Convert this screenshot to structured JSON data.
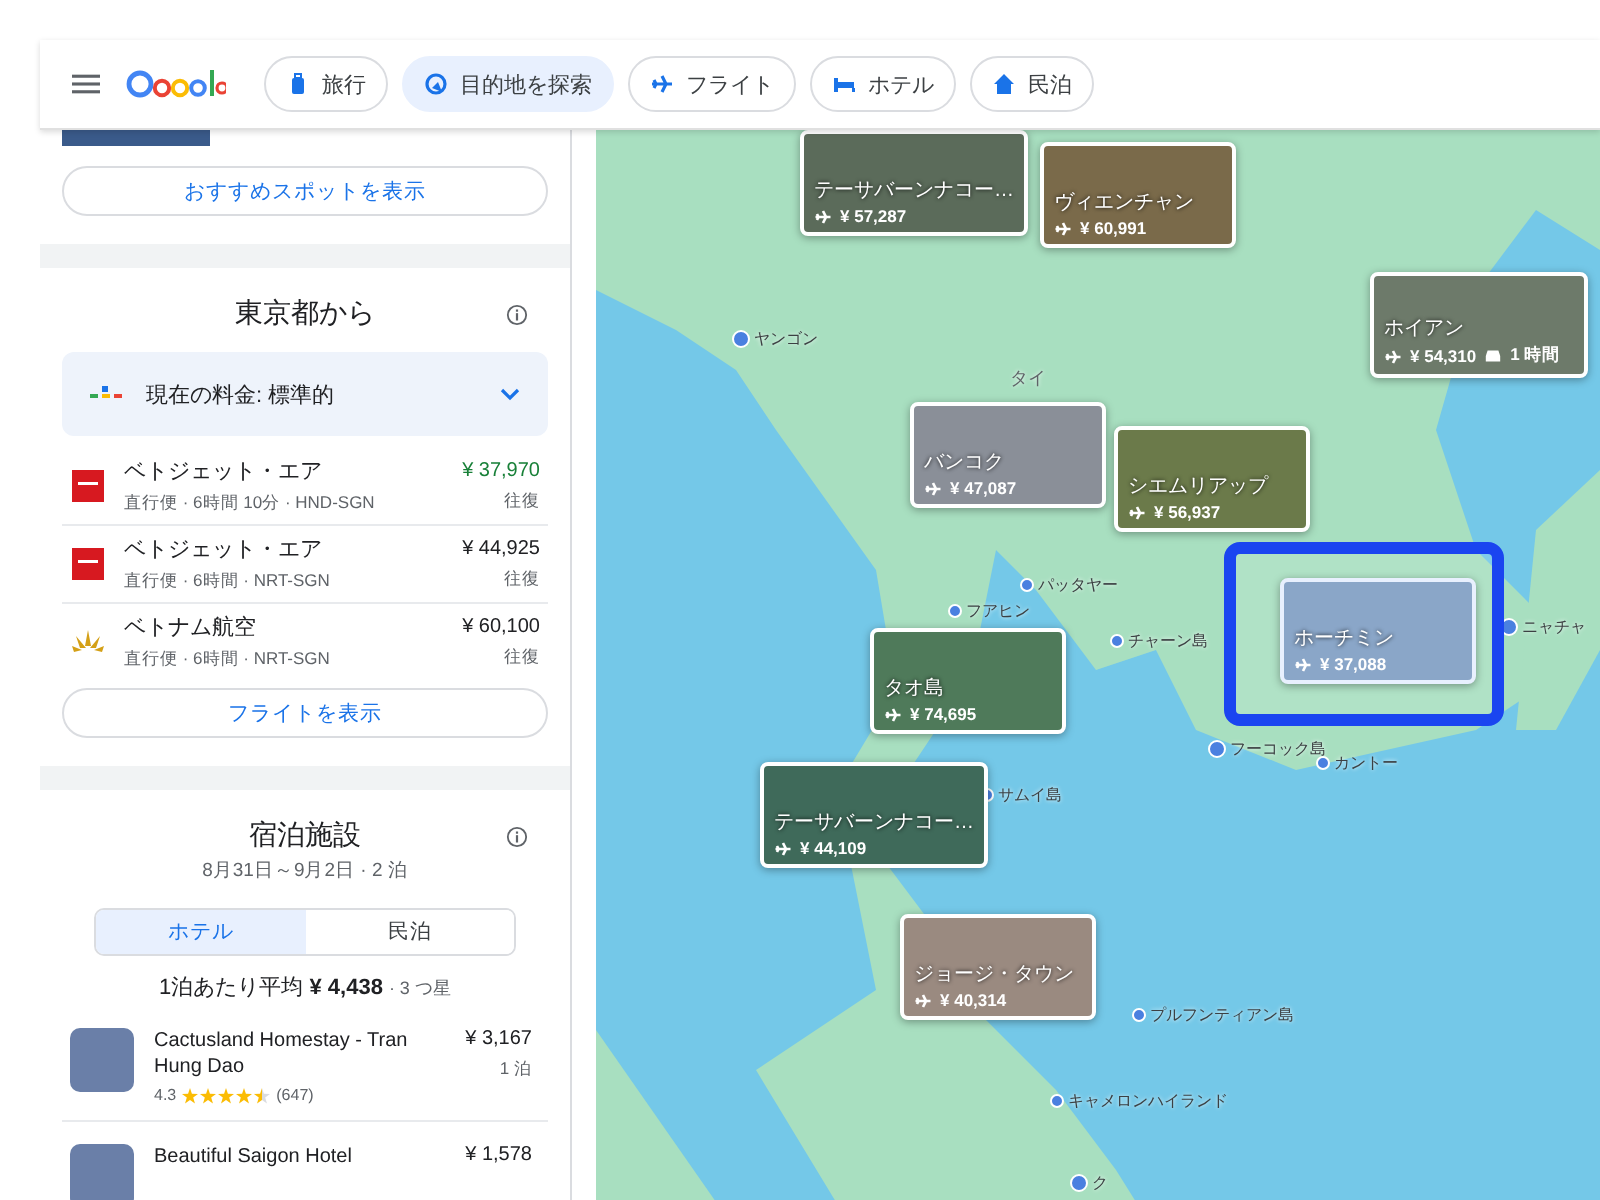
{
  "header": {
    "nav": [
      {
        "label": "旅行",
        "kind": "suitcase",
        "selected": false
      },
      {
        "label": "目的地を探索",
        "kind": "explore",
        "selected": true
      },
      {
        "label": "フライト",
        "kind": "plane",
        "selected": false
      },
      {
        "label": "ホテル",
        "kind": "bed",
        "selected": false
      },
      {
        "label": "民泊",
        "kind": "house",
        "selected": false
      }
    ]
  },
  "sidebar": {
    "spots_button": "おすすめスポットを表示",
    "flights": {
      "title": "東京都から",
      "price_status": "現在の料金: 標準的",
      "rows": [
        {
          "airline": "ベトジェット・エア",
          "details": "直行便 · 6時間 10分 · HND-SGN",
          "price": "¥ 37,970",
          "trip": "往復",
          "kind": "square",
          "color": "#188038"
        },
        {
          "airline": "ベトジェット・エア",
          "details": "直行便 · 6時間 · NRT-SGN",
          "price": "¥ 44,925",
          "trip": "往復",
          "kind": "square",
          "color": "#202124"
        },
        {
          "airline": "ベトナム航空",
          "details": "直行便 · 6時間 · NRT-SGN",
          "price": "¥ 60,100",
          "trip": "往復",
          "kind": "flower",
          "color": "#202124"
        }
      ],
      "button": "フライトを表示"
    },
    "stays": {
      "title": "宿泊施設",
      "dates": "8月31日～9月2日 · 2 泊",
      "tabs": [
        {
          "label": "ホテル",
          "selected": true
        },
        {
          "label": "民泊",
          "selected": false
        }
      ],
      "average": "1泊あたり平均 **¥ 4,438**",
      "class": "· 3 つ星",
      "hotels": [
        {
          "name": "Cactusland Homestay - Tran Hung Dao",
          "price": "¥ 3,167",
          "per": "1 泊",
          "rating": "4.3",
          "stars": 4.5,
          "reviews": "(647)"
        },
        {
          "name": "Beautiful Saigon Hotel",
          "price": "¥ 1,578"
        }
      ]
    }
  },
  "map": {
    "places": [
      {
        "name": "ヤンゴン",
        "kind": "city"
      },
      {
        "name": "タイ",
        "kind": "country"
      },
      {
        "name": "パッタヤー",
        "kind": "town"
      },
      {
        "name": "フアヒン",
        "kind": "town"
      },
      {
        "name": "チャーン島",
        "kind": "town"
      },
      {
        "name": "ニャチャ",
        "kind": "city"
      },
      {
        "name": "フーコック島",
        "kind": "city"
      },
      {
        "name": "カントー",
        "kind": "town"
      },
      {
        "name": "サムイ島",
        "kind": "town"
      },
      {
        "name": "プルフンティアン島",
        "kind": "town"
      },
      {
        "name": "キャメロンハイランド",
        "kind": "town"
      },
      {
        "name": "ク",
        "kind": "city"
      }
    ],
    "destinations": [
      {
        "name": "テーサバーンナコー…",
        "price": "¥ 57,287",
        "selected": false
      },
      {
        "name": "ヴィエンチャン",
        "price": "¥ 60,991",
        "selected": false
      },
      {
        "name": "ホイアン",
        "price": "¥ 54,310",
        "extra": "1 時間",
        "selected": false
      },
      {
        "name": "バンコク",
        "price": "¥ 47,087",
        "selected": false
      },
      {
        "name": "シエムリアップ",
        "price": "¥ 56,937",
        "selected": false
      },
      {
        "name": "ホーチミン",
        "price": "¥ 37,088",
        "selected": true
      },
      {
        "name": "タオ島",
        "price": "¥ 74,695",
        "selected": false
      },
      {
        "name": "テーサバーンナコー…",
        "price": "¥ 44,109",
        "selected": false
      },
      {
        "name": "ジョージ・タウン",
        "price": "¥ 40,314",
        "selected": false
      }
    ]
  }
}
